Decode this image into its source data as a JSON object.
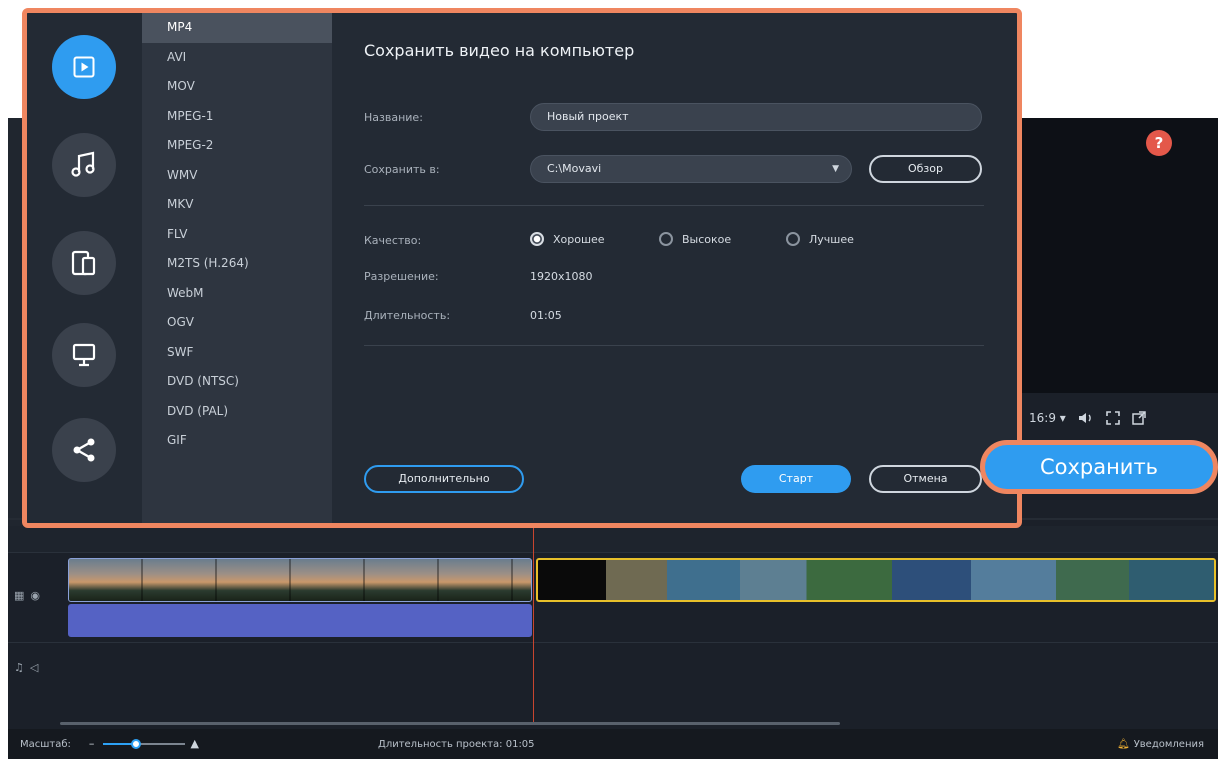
{
  "app": {
    "help_label": "?",
    "player": {
      "aspect_label": "16:9 ▾"
    },
    "statusbar": {
      "zoom_label": "Масштаб:",
      "zoom_level": 0.4,
      "duration_label": "Длительность проекта: 01:05",
      "notifications_label": "Уведомления"
    }
  },
  "save_button": {
    "label": "Сохранить"
  },
  "dialog": {
    "title": "Сохранить видео на компьютер",
    "categories": [
      {
        "icon": "video-icon",
        "active": true
      },
      {
        "icon": "music-icon",
        "active": false
      },
      {
        "icon": "devices-icon",
        "active": false
      },
      {
        "icon": "monitor-icon",
        "active": false
      },
      {
        "icon": "share-icon",
        "active": false
      }
    ],
    "formats": [
      "MP4",
      "AVI",
      "MOV",
      "MPEG-1",
      "MPEG-2",
      "WMV",
      "MKV",
      "FLV",
      "M2TS (H.264)",
      "WebM",
      "OGV",
      "SWF",
      "DVD (NTSC)",
      "DVD (PAL)",
      "GIF"
    ],
    "selected_format": "MP4",
    "name_label": "Название:",
    "name_value": "Новый проект",
    "save_to_label": "Сохранить в:",
    "save_to_value": "C:\\Movavi",
    "browse_label": "Обзор",
    "quality_label": "Качество:",
    "quality_options": [
      "Хорошее",
      "Высокое",
      "Лучшее"
    ],
    "quality_selected": "Хорошее",
    "resolution_label": "Разрешение:",
    "resolution_value": "1920x1080",
    "duration_label": "Длительность:",
    "duration_value": "01:05",
    "advanced_label": "Дополнительно",
    "start_label": "Старт",
    "cancel_label": "Отмена"
  },
  "colors": {
    "accent": "#2f9cf0",
    "highlight_border": "#ef8660",
    "dialog_bg": "#232a34",
    "format_list_bg": "#2e3540",
    "selected_clip_border": "#e8c02a",
    "audio_clip": "#5562c4"
  }
}
